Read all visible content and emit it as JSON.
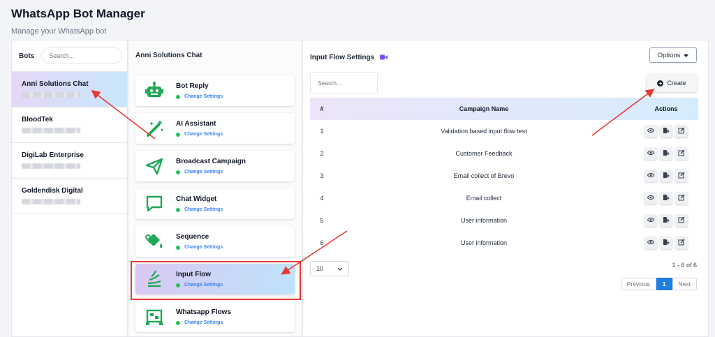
{
  "header": {
    "title": "WhatsApp Bot Manager",
    "subtitle": "Manage your WhatsApp bot"
  },
  "bots": {
    "label": "Bots",
    "search_placeholder": "Search...",
    "items": [
      {
        "name": "Anni Solutions Chat",
        "active": true
      },
      {
        "name": "BloodTek",
        "active": false
      },
      {
        "name": "DigiLab Enterprise",
        "active": false
      },
      {
        "name": "Goldendisk Digital",
        "active": false
      }
    ]
  },
  "chat_panel": {
    "title": "Anni Solutions Chat",
    "cards": [
      {
        "title": "Bot Reply",
        "link": "Change Settings",
        "icon": "robot-icon"
      },
      {
        "title": "AI Assistant",
        "link": "Change Settings",
        "icon": "magic-wand-icon"
      },
      {
        "title": "Broadcast Campaign",
        "link": "Change Settings",
        "icon": "paper-plane-icon"
      },
      {
        "title": "Chat Widget",
        "link": "Change Settings",
        "icon": "chat-bubble-icon"
      },
      {
        "title": "Sequence",
        "link": "Change Settings",
        "icon": "paint-bucket-icon"
      },
      {
        "title": "Input Flow",
        "link": "Change Settings",
        "icon": "stack-icon",
        "active": true
      },
      {
        "title": "Whatsapp Flows",
        "link": "Change Settings",
        "icon": "flow-icon"
      }
    ]
  },
  "main": {
    "title": "Input Flow Settings",
    "title_icon": "video-camera-icon",
    "options_label": "Options",
    "search_placeholder": "Search...",
    "create_label": "Create",
    "table": {
      "headers": [
        "#",
        "Campaign Name",
        "Actions"
      ],
      "rows": [
        {
          "num": "1",
          "name": "Validation based input flow test"
        },
        {
          "num": "2",
          "name": "Customer Feedback"
        },
        {
          "num": "3",
          "name": "Email collect of Brevo"
        },
        {
          "num": "4",
          "name": "Email collect"
        },
        {
          "num": "5",
          "name": "User information"
        },
        {
          "num": "6",
          "name": "User information"
        }
      ],
      "row_action_icons": [
        "eye-icon",
        "export-icon",
        "edit-icon"
      ]
    },
    "page_size": "10",
    "range_text": "1 - 6 of 6",
    "pagination": {
      "previous": "Previous",
      "current": "1",
      "next": "Next"
    }
  },
  "colors": {
    "active_gradient_start": "#e5d8f7",
    "active_gradient_end": "#c9e6fb",
    "icon_green": "#1fa855",
    "link_blue": "#3b82f6",
    "annotation_red": "#e53935",
    "page_blue": "#1d7fe0"
  }
}
